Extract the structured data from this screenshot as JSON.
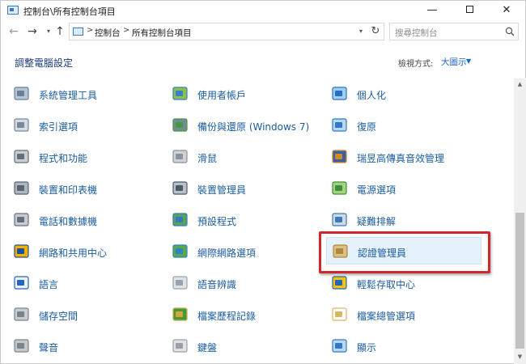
{
  "window": {
    "title": "控制台\\所有控制台項目",
    "minimize_glyph": "—",
    "close_glyph": "✕"
  },
  "nav": {
    "back_glyph": "←",
    "forward_glyph": "→",
    "recent_glyph": "▾",
    "up_glyph": "↑",
    "breadcrumbs": [
      "控制台",
      "所有控制台項目"
    ],
    "separator": ">",
    "dropdown_glyph": "▾",
    "refresh_glyph": "↻",
    "search_placeholder": "搜尋控制台"
  },
  "header": {
    "title": "調整電腦設定",
    "view_by_label": "檢視方式:",
    "view_by_value": "大圖示",
    "view_by_caret": "▼"
  },
  "items": [
    {
      "label": "系統管理工具",
      "icon": "admin-tools-icon"
    },
    {
      "label": "使用者帳戶",
      "icon": "user-accounts-icon"
    },
    {
      "label": "個人化",
      "icon": "personalization-icon"
    },
    {
      "label": "索引選項",
      "icon": "indexing-icon"
    },
    {
      "label": "備份與還原 (Windows 7)",
      "icon": "backup-restore-icon"
    },
    {
      "label": "復原",
      "icon": "recovery-icon"
    },
    {
      "label": "程式和功能",
      "icon": "programs-features-icon"
    },
    {
      "label": "滑鼠",
      "icon": "mouse-icon"
    },
    {
      "label": "瑞昱高傳真音效管理",
      "icon": "realtek-audio-icon"
    },
    {
      "label": "裝置和印表機",
      "icon": "devices-printers-icon"
    },
    {
      "label": "裝置管理員",
      "icon": "device-manager-icon"
    },
    {
      "label": "電源選項",
      "icon": "power-options-icon"
    },
    {
      "label": "電話和數據機",
      "icon": "phone-modem-icon"
    },
    {
      "label": "預設程式",
      "icon": "default-programs-icon"
    },
    {
      "label": "疑難排解",
      "icon": "troubleshooting-icon"
    },
    {
      "label": "網路和共用中心",
      "icon": "network-sharing-icon"
    },
    {
      "label": "網際網路選項",
      "icon": "internet-options-icon"
    },
    {
      "label": "認證管理員",
      "icon": "credential-manager-icon",
      "selected": true
    },
    {
      "label": "語言",
      "icon": "language-icon"
    },
    {
      "label": "語音辨識",
      "icon": "speech-recognition-icon"
    },
    {
      "label": "輕鬆存取中心",
      "icon": "ease-of-access-icon"
    },
    {
      "label": "儲存空間",
      "icon": "storage-spaces-icon"
    },
    {
      "label": "檔案歷程記錄",
      "icon": "file-history-icon"
    },
    {
      "label": "檔案總管選項",
      "icon": "file-explorer-options-icon"
    },
    {
      "label": "聲音",
      "icon": "sound-icon"
    },
    {
      "label": "鍵盤",
      "icon": "keyboard-icon"
    },
    {
      "label": "顯示",
      "icon": "display-icon"
    }
  ],
  "scrollbar": {
    "up_glyph": "▲",
    "down_glyph": "▼"
  },
  "colors": {
    "link": "#1a5b9e",
    "highlight_border": "#d0262e",
    "selected_bg": "#e5f1fb",
    "accent": "#1a66c4"
  }
}
